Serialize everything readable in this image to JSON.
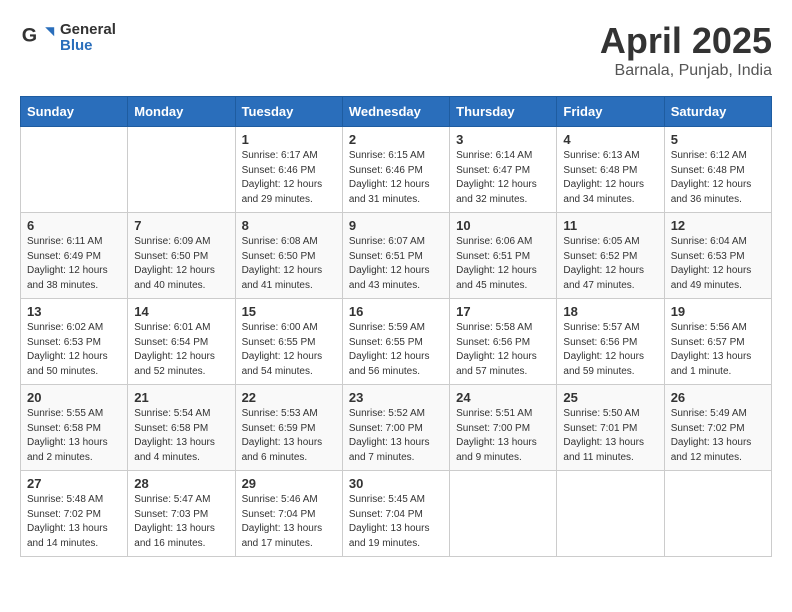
{
  "header": {
    "logo_general": "General",
    "logo_blue": "Blue",
    "title": "April 2025",
    "subtitle": "Barnala, Punjab, India"
  },
  "weekdays": [
    "Sunday",
    "Monday",
    "Tuesday",
    "Wednesday",
    "Thursday",
    "Friday",
    "Saturday"
  ],
  "weeks": [
    [
      {
        "day": "",
        "info": ""
      },
      {
        "day": "",
        "info": ""
      },
      {
        "day": "1",
        "info": "Sunrise: 6:17 AM\nSunset: 6:46 PM\nDaylight: 12 hours and 29 minutes."
      },
      {
        "day": "2",
        "info": "Sunrise: 6:15 AM\nSunset: 6:46 PM\nDaylight: 12 hours and 31 minutes."
      },
      {
        "day": "3",
        "info": "Sunrise: 6:14 AM\nSunset: 6:47 PM\nDaylight: 12 hours and 32 minutes."
      },
      {
        "day": "4",
        "info": "Sunrise: 6:13 AM\nSunset: 6:48 PM\nDaylight: 12 hours and 34 minutes."
      },
      {
        "day": "5",
        "info": "Sunrise: 6:12 AM\nSunset: 6:48 PM\nDaylight: 12 hours and 36 minutes."
      }
    ],
    [
      {
        "day": "6",
        "info": "Sunrise: 6:11 AM\nSunset: 6:49 PM\nDaylight: 12 hours and 38 minutes."
      },
      {
        "day": "7",
        "info": "Sunrise: 6:09 AM\nSunset: 6:50 PM\nDaylight: 12 hours and 40 minutes."
      },
      {
        "day": "8",
        "info": "Sunrise: 6:08 AM\nSunset: 6:50 PM\nDaylight: 12 hours and 41 minutes."
      },
      {
        "day": "9",
        "info": "Sunrise: 6:07 AM\nSunset: 6:51 PM\nDaylight: 12 hours and 43 minutes."
      },
      {
        "day": "10",
        "info": "Sunrise: 6:06 AM\nSunset: 6:51 PM\nDaylight: 12 hours and 45 minutes."
      },
      {
        "day": "11",
        "info": "Sunrise: 6:05 AM\nSunset: 6:52 PM\nDaylight: 12 hours and 47 minutes."
      },
      {
        "day": "12",
        "info": "Sunrise: 6:04 AM\nSunset: 6:53 PM\nDaylight: 12 hours and 49 minutes."
      }
    ],
    [
      {
        "day": "13",
        "info": "Sunrise: 6:02 AM\nSunset: 6:53 PM\nDaylight: 12 hours and 50 minutes."
      },
      {
        "day": "14",
        "info": "Sunrise: 6:01 AM\nSunset: 6:54 PM\nDaylight: 12 hours and 52 minutes."
      },
      {
        "day": "15",
        "info": "Sunrise: 6:00 AM\nSunset: 6:55 PM\nDaylight: 12 hours and 54 minutes."
      },
      {
        "day": "16",
        "info": "Sunrise: 5:59 AM\nSunset: 6:55 PM\nDaylight: 12 hours and 56 minutes."
      },
      {
        "day": "17",
        "info": "Sunrise: 5:58 AM\nSunset: 6:56 PM\nDaylight: 12 hours and 57 minutes."
      },
      {
        "day": "18",
        "info": "Sunrise: 5:57 AM\nSunset: 6:56 PM\nDaylight: 12 hours and 59 minutes."
      },
      {
        "day": "19",
        "info": "Sunrise: 5:56 AM\nSunset: 6:57 PM\nDaylight: 13 hours and 1 minute."
      }
    ],
    [
      {
        "day": "20",
        "info": "Sunrise: 5:55 AM\nSunset: 6:58 PM\nDaylight: 13 hours and 2 minutes."
      },
      {
        "day": "21",
        "info": "Sunrise: 5:54 AM\nSunset: 6:58 PM\nDaylight: 13 hours and 4 minutes."
      },
      {
        "day": "22",
        "info": "Sunrise: 5:53 AM\nSunset: 6:59 PM\nDaylight: 13 hours and 6 minutes."
      },
      {
        "day": "23",
        "info": "Sunrise: 5:52 AM\nSunset: 7:00 PM\nDaylight: 13 hours and 7 minutes."
      },
      {
        "day": "24",
        "info": "Sunrise: 5:51 AM\nSunset: 7:00 PM\nDaylight: 13 hours and 9 minutes."
      },
      {
        "day": "25",
        "info": "Sunrise: 5:50 AM\nSunset: 7:01 PM\nDaylight: 13 hours and 11 minutes."
      },
      {
        "day": "26",
        "info": "Sunrise: 5:49 AM\nSunset: 7:02 PM\nDaylight: 13 hours and 12 minutes."
      }
    ],
    [
      {
        "day": "27",
        "info": "Sunrise: 5:48 AM\nSunset: 7:02 PM\nDaylight: 13 hours and 14 minutes."
      },
      {
        "day": "28",
        "info": "Sunrise: 5:47 AM\nSunset: 7:03 PM\nDaylight: 13 hours and 16 minutes."
      },
      {
        "day": "29",
        "info": "Sunrise: 5:46 AM\nSunset: 7:04 PM\nDaylight: 13 hours and 17 minutes."
      },
      {
        "day": "30",
        "info": "Sunrise: 5:45 AM\nSunset: 7:04 PM\nDaylight: 13 hours and 19 minutes."
      },
      {
        "day": "",
        "info": ""
      },
      {
        "day": "",
        "info": ""
      },
      {
        "day": "",
        "info": ""
      }
    ]
  ]
}
